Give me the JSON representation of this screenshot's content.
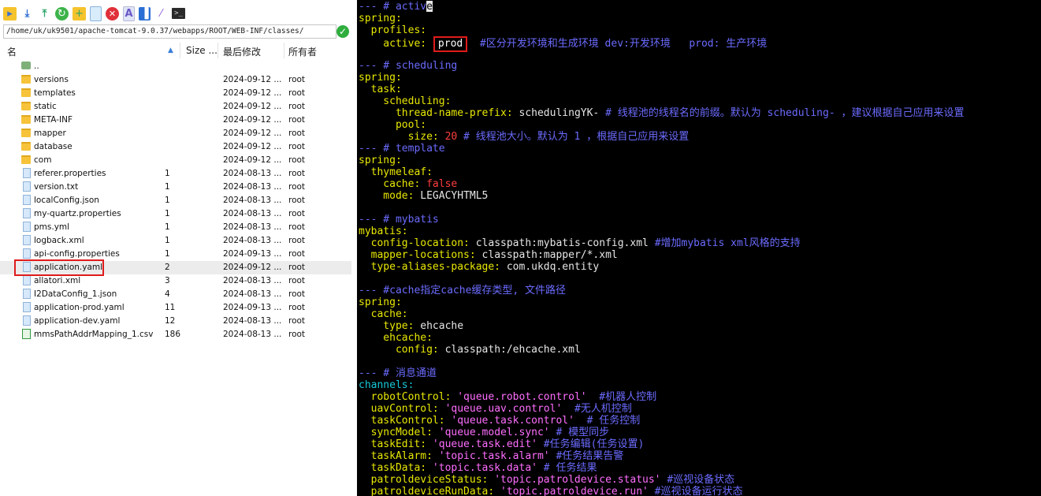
{
  "toolbar": {
    "icons": [
      "folder-open-icon",
      "download-icon",
      "upload-icon",
      "refresh-icon",
      "new-folder-icon",
      "new-file-icon",
      "delete-icon",
      "rename-icon",
      "properties-icon",
      "magic-wand-icon",
      "terminal-icon"
    ]
  },
  "path": "/home/uk/uk9501/apache-tomcat-9.0.37/webapps/ROOT/WEB-INF/classes/",
  "columns": {
    "name": "名",
    "size": "Size ...",
    "modified": "最后修改",
    "owner": "所有者"
  },
  "files": [
    {
      "type": "parent",
      "name": "..",
      "size": "",
      "date": "",
      "owner": ""
    },
    {
      "type": "folder",
      "name": "versions",
      "size": "",
      "date": "2024-09-12 ...",
      "owner": "root"
    },
    {
      "type": "folder",
      "name": "templates",
      "size": "",
      "date": "2024-09-12 ...",
      "owner": "root"
    },
    {
      "type": "folder",
      "name": "static",
      "size": "",
      "date": "2024-09-12 ...",
      "owner": "root"
    },
    {
      "type": "folder",
      "name": "META-INF",
      "size": "",
      "date": "2024-09-12 ...",
      "owner": "root"
    },
    {
      "type": "folder",
      "name": "mapper",
      "size": "",
      "date": "2024-09-12 ...",
      "owner": "root"
    },
    {
      "type": "folder",
      "name": "database",
      "size": "",
      "date": "2024-09-12 ...",
      "owner": "root"
    },
    {
      "type": "folder",
      "name": "com",
      "size": "",
      "date": "2024-09-12 ...",
      "owner": "root"
    },
    {
      "type": "file",
      "name": "referer.properties",
      "size": "1",
      "date": "2024-08-13 ...",
      "owner": "root"
    },
    {
      "type": "file",
      "name": "version.txt",
      "size": "1",
      "date": "2024-08-13 ...",
      "owner": "root"
    },
    {
      "type": "file",
      "name": "localConfig.json",
      "size": "1",
      "date": "2024-08-13 ...",
      "owner": "root"
    },
    {
      "type": "file",
      "name": "my-quartz.properties",
      "size": "1",
      "date": "2024-08-13 ...",
      "owner": "root"
    },
    {
      "type": "file",
      "name": "pms.yml",
      "size": "1",
      "date": "2024-08-13 ...",
      "owner": "root"
    },
    {
      "type": "file",
      "name": "logback.xml",
      "size": "1",
      "date": "2024-08-13 ...",
      "owner": "root"
    },
    {
      "type": "file",
      "name": "api-config.properties",
      "size": "1",
      "date": "2024-09-13 ...",
      "owner": "root"
    },
    {
      "type": "file",
      "name": "application.yaml",
      "size": "2",
      "date": "2024-09-12 ...",
      "owner": "root",
      "selected": true
    },
    {
      "type": "file",
      "name": "allatori.xml",
      "size": "3",
      "date": "2024-08-13 ...",
      "owner": "root"
    },
    {
      "type": "file",
      "name": "I2DataConfig_1.json",
      "size": "4",
      "date": "2024-08-13 ...",
      "owner": "root"
    },
    {
      "type": "file",
      "name": "application-prod.yaml",
      "size": "11",
      "date": "2024-09-13 ...",
      "owner": "root"
    },
    {
      "type": "file",
      "name": "application-dev.yaml",
      "size": "12",
      "date": "2024-08-13 ...",
      "owner": "root"
    },
    {
      "type": "csv",
      "name": "mmsPathAddrMapping_1.csv",
      "size": "186",
      "date": "2024-08-13 ...",
      "owner": "root"
    }
  ],
  "terminal": {
    "lines": [
      [
        [
          "cm",
          "--- # activ"
        ],
        [
          "cursor",
          "e"
        ]
      ],
      [
        [
          "ky",
          "spring:"
        ]
      ],
      [
        [
          "ky",
          "  profiles:"
        ]
      ],
      [
        [
          "ky",
          "    active: "
        ],
        [
          "prod",
          "prod"
        ],
        [
          "cm",
          "  #区分开发环境和生成环境 dev:开发环境   prod: 生产环境"
        ]
      ],
      [],
      [
        [
          "cm",
          "--- # scheduling"
        ]
      ],
      [
        [
          "ky",
          "spring:"
        ]
      ],
      [
        [
          "ky",
          "  task:"
        ]
      ],
      [
        [
          "ky",
          "    scheduling:"
        ]
      ],
      [
        [
          "ky",
          "      thread-name-prefix: "
        ],
        [
          "vl",
          "schedulingYK- "
        ],
        [
          "cm",
          "# 线程池的线程名的前缀。默认为 scheduling- ，建议根据自己应用来设置"
        ]
      ],
      [
        [
          "ky",
          "      pool:"
        ]
      ],
      [
        [
          "ky",
          "        size: "
        ],
        [
          "nm",
          "20"
        ],
        [
          "cm",
          " # 线程池大小。默认为 1 ，根据自己应用来设置"
        ]
      ],
      [
        [
          "cm",
          "--- # template"
        ]
      ],
      [
        [
          "ky",
          "spring:"
        ]
      ],
      [
        [
          "ky",
          "  thymeleaf:"
        ]
      ],
      [
        [
          "ky",
          "    cache: "
        ],
        [
          "nm",
          "false"
        ]
      ],
      [
        [
          "ky",
          "    mode: "
        ],
        [
          "vl",
          "LEGACYHTML5"
        ]
      ],
      [],
      [
        [
          "cm",
          "--- # mybatis"
        ]
      ],
      [
        [
          "ky",
          "mybatis:"
        ]
      ],
      [
        [
          "ky",
          "  config-location: "
        ],
        [
          "vl",
          "classpath:mybatis-config.xml "
        ],
        [
          "cm",
          "#增加mybatis xml风格的支持"
        ]
      ],
      [
        [
          "ky",
          "  mapper-locations: "
        ],
        [
          "vl",
          "classpath:mapper/*.xml"
        ]
      ],
      [
        [
          "ky",
          "  type-aliases-package: "
        ],
        [
          "vl",
          "com.ukdq.entity"
        ]
      ],
      [],
      [
        [
          "cm",
          "--- #cache指定cache缓存类型, 文件路径"
        ]
      ],
      [
        [
          "ky",
          "spring:"
        ]
      ],
      [
        [
          "ky",
          "  cache:"
        ]
      ],
      [
        [
          "ky",
          "    type: "
        ],
        [
          "vl",
          "ehcache"
        ]
      ],
      [
        [
          "ky",
          "    ehcache:"
        ]
      ],
      [
        [
          "ky",
          "      config: "
        ],
        [
          "vl",
          "classpath:/ehcache.xml"
        ]
      ],
      [],
      [
        [
          "cm",
          "--- # 消息通道"
        ]
      ],
      [
        [
          "ky2",
          "channels:"
        ]
      ],
      [
        [
          "ky",
          "  robotControl: "
        ],
        [
          "st",
          "'queue.robot.control'"
        ],
        [
          "cm",
          "  #机器人控制"
        ]
      ],
      [
        [
          "ky",
          "  uavControl: "
        ],
        [
          "st",
          "'queue.uav.control'"
        ],
        [
          "cm",
          "  #无人机控制"
        ]
      ],
      [
        [
          "ky",
          "  taskControl: "
        ],
        [
          "st",
          "'queue.task.control'"
        ],
        [
          "cm",
          "  # 任务控制"
        ]
      ],
      [
        [
          "ky",
          "  syncModel: "
        ],
        [
          "st",
          "'queue.model.sync'"
        ],
        [
          "cm",
          " # 模型同步"
        ]
      ],
      [
        [
          "ky",
          "  taskEdit: "
        ],
        [
          "st",
          "'queue.task.edit'"
        ],
        [
          "cm",
          " #任务编辑(任务设置)"
        ]
      ],
      [
        [
          "ky",
          "  taskAlarm: "
        ],
        [
          "st",
          "'topic.task.alarm'"
        ],
        [
          "cm",
          " #任务结果告警"
        ]
      ],
      [
        [
          "ky",
          "  taskData: "
        ],
        [
          "st",
          "'topic.task.data'"
        ],
        [
          "cm",
          " # 任务结果"
        ]
      ],
      [
        [
          "ky",
          "  patroldeviceStatus: "
        ],
        [
          "st",
          "'topic.patroldevice.status'"
        ],
        [
          "cm",
          " #巡视设备状态"
        ]
      ],
      [
        [
          "ky",
          "  patroldeviceRunData: "
        ],
        [
          "st",
          "'topic.patroldevice.run'"
        ],
        [
          "cm",
          " #巡视设备运行状态"
        ]
      ]
    ]
  }
}
